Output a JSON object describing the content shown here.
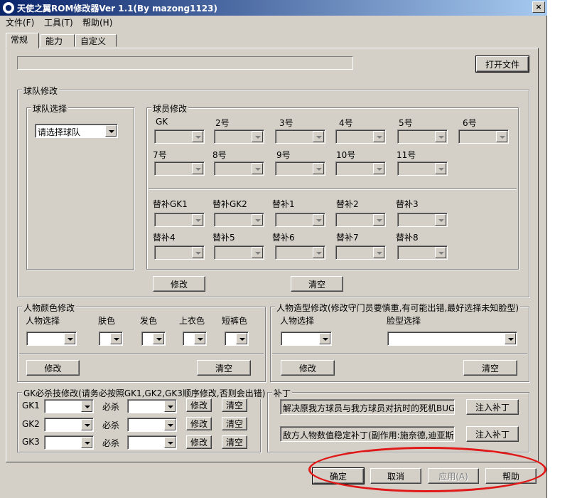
{
  "window": {
    "title": "天使之翼ROM修改器Ver 1.1(By mazong1123)",
    "icon": "app-icon",
    "close_label": "×"
  },
  "menu": [
    "文件(F)",
    "工具(T)",
    "帮助(H)"
  ],
  "tabs": [
    "常规",
    "能力",
    "自定义"
  ],
  "top": {
    "file_path": "",
    "open_button": "打开文件"
  },
  "team_group": {
    "legend": "球队修改",
    "select_group": {
      "legend": "球队选择",
      "combo_value": "请选择球队"
    },
    "player_group": {
      "legend": "球员修改",
      "starters_row1": [
        "GK",
        "2号",
        "3号",
        "4号",
        "5号",
        "6号"
      ],
      "starters_row2": [
        "7号",
        "8号",
        "9号",
        "10号",
        "11号"
      ],
      "subs_row1": [
        "替补GK1",
        "替补GK2",
        "替补1",
        "替补2",
        "替补3"
      ],
      "subs_row2": [
        "替补4",
        "替补5",
        "替补6",
        "替补7",
        "替补8"
      ]
    },
    "modify_button": "修改",
    "clear_button": "清空"
  },
  "color_group": {
    "legend": "人物颜色修改",
    "labels": [
      "人物选择",
      "肤色",
      "发色",
      "上衣色",
      "短裤色"
    ],
    "modify_button": "修改",
    "clear_button": "清空"
  },
  "shape_group": {
    "legend": "人物造型修改(修改守门员要慎重,有可能出错,最好选择未知脸型)",
    "person_label": "人物选择",
    "face_label": "脸型选择",
    "modify_button": "修改",
    "clear_button": "清空"
  },
  "gk_group": {
    "legend": "GK必杀技修改(请务必按照GK1,GK2,GK3顺序修改,否则会出错)",
    "rows": [
      {
        "label": "GK1",
        "skill_label": "必杀",
        "modify": "修改",
        "clear": "清空"
      },
      {
        "label": "GK2",
        "skill_label": "必杀",
        "modify": "修改",
        "clear": "清空"
      },
      {
        "label": "GK3",
        "skill_label": "必杀",
        "modify": "修改",
        "clear": "清空"
      }
    ]
  },
  "patch_group": {
    "legend": "补丁",
    "patches": [
      {
        "text": "解决原我方球员与我方球员对抗时的死机BUG",
        "button": "注入补丁"
      },
      {
        "text": "敌方人物数值稳定补丁(副作用:施奈德,迪亚斯",
        "button": "注入补丁"
      }
    ]
  },
  "footer": {
    "ok": "确定",
    "cancel": "取消",
    "apply": "应用(A)",
    "help": "帮助"
  },
  "annotation_color": "#e01818"
}
